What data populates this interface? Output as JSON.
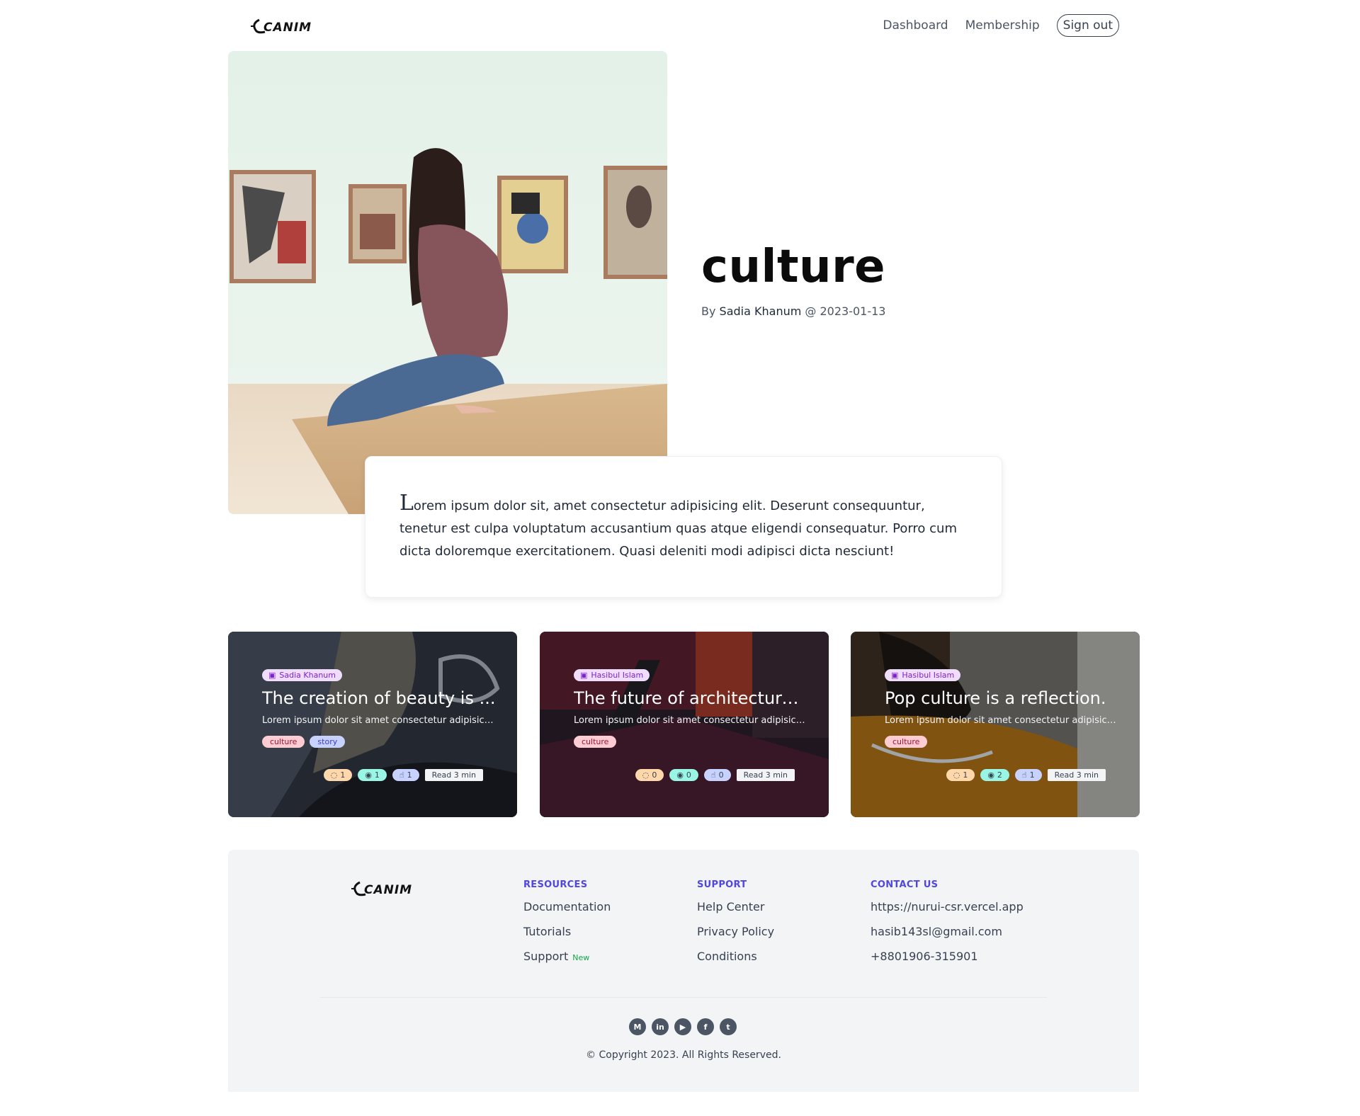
{
  "header": {
    "logo_text": "CANIM",
    "nav": [
      "Dashboard",
      "Membership"
    ],
    "signout_label": "Sign out"
  },
  "hero": {
    "title": "culture",
    "by": "By",
    "author": "Sadia Khanum",
    "at": "@",
    "date": "2023-01-13",
    "excerpt_first_letter": "L",
    "excerpt_rest": "orem ipsum dolor sit, amet consectetur adipisicing elit. Deserunt consequuntur, tenetur est culpa voluptatum accusantium quas atque eligendi consequatur. Porro cum dicta doloremque exercitationem. Quasi deleniti modi adipisci dicta nesciunt!"
  },
  "cards": [
    {
      "author": "Sadia Khanum",
      "title": "The creation of beauty is ...",
      "desc": "Lorem ipsum dolor sit amet consectetur adipisicing...",
      "tags": [
        "culture",
        "story"
      ],
      "comments": "1",
      "views": "1",
      "likes": "1",
      "read": "Read 3 min"
    },
    {
      "author": "Hasibul Islam",
      "title": "The future of architecture...",
      "desc": "Lorem ipsum dolor sit amet consectetur adipisicing...",
      "tags": [
        "culture"
      ],
      "comments": "0",
      "views": "0",
      "likes": "0",
      "read": "Read 3 min"
    },
    {
      "author": "Hasibul Islam",
      "title": "Pop culture is a reflection.",
      "desc": "Lorem ipsum dolor sit amet consectetur adipisicing...",
      "tags": [
        "culture"
      ],
      "comments": "1",
      "views": "2",
      "likes": "1",
      "read": "Read 3 min"
    }
  ],
  "footer": {
    "resources": {
      "heading": "RESOURCES",
      "links": [
        "Documentation",
        "Tutorials",
        "Support"
      ],
      "new_badge": "New"
    },
    "support": {
      "heading": "SUPPORT",
      "links": [
        "Help Center",
        "Privacy Policy",
        "Conditions"
      ]
    },
    "contact": {
      "heading": "CONTACT US",
      "links": [
        "https://nurui-csr.vercel.app",
        "hasib143sl@gmail.com",
        "+8801906-315901"
      ]
    },
    "socials": [
      "medium-icon",
      "linkedin-icon",
      "youtube-icon",
      "facebook-icon",
      "twitter-icon"
    ],
    "copyright": "© Copyright 2023. All Rights Reserved."
  }
}
